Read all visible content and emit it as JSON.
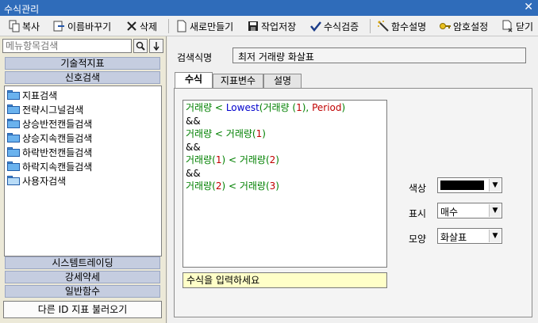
{
  "window": {
    "title": "수식관리"
  },
  "toolbar": {
    "copy_label": "복사",
    "rename_label": "이름바꾸기",
    "delete_label": "삭제",
    "new_label": "새로만들기",
    "save_label": "작업저장",
    "verify_label": "수식검증",
    "func_help_label": "함수설명",
    "password_label": "암호설정",
    "close_label": "닫기"
  },
  "sidebar": {
    "search_placeholder": "메뉴항목검색",
    "groups_top": [
      "기술적지표",
      "신호검색"
    ],
    "tree": [
      "지표검색",
      "전략시그널검색",
      "상승반전캔들검색",
      "상승지속캔들검색",
      "하락반전캔들검색",
      "하락지속캔들검색",
      "사용자검색"
    ],
    "groups_bottom": [
      "시스템트레이딩",
      "강세약세",
      "일반함수"
    ],
    "load_button": "다른 ID 지표 불러오기"
  },
  "main": {
    "name_label": "검색식명",
    "name_value": "최저 거래량 화살표",
    "tabs": [
      "수식",
      "지표변수",
      "설명"
    ],
    "code": [
      [
        "거래량 < ",
        "Lowest",
        "(거래량 (",
        "1",
        "), ",
        "Period",
        ")"
      ],
      [
        "&&"
      ],
      [
        "거래량 < 거래량(",
        "1",
        ")"
      ],
      [
        "&&"
      ],
      [
        "거래량(",
        "1",
        ") < 거래량(",
        "2",
        ")"
      ],
      [
        "&&"
      ],
      [
        "거래량(",
        "2",
        ") < 거래량(",
        "3",
        ")"
      ]
    ],
    "input_placeholder": "수식을 입력하세요",
    "color_label": "색상",
    "display_label": "표시",
    "display_value": "매수",
    "shape_label": "모양",
    "shape_value": "화살표",
    "color_value": "#000000"
  }
}
